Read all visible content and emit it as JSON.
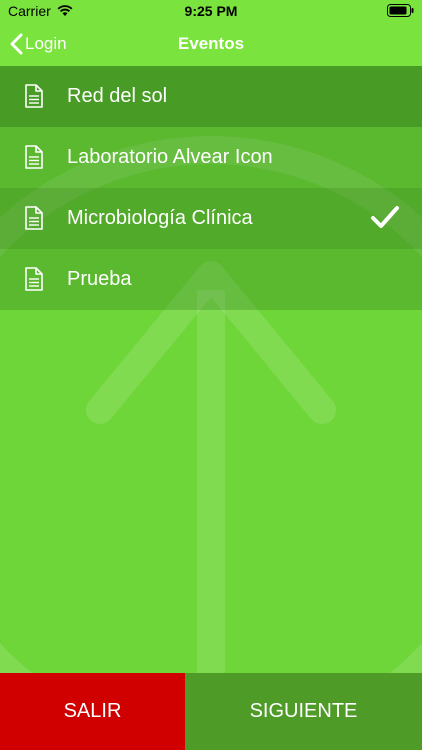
{
  "status_bar": {
    "carrier": "Carrier",
    "time": "9:25 PM"
  },
  "nav": {
    "back_label": "Login",
    "title": "Eventos"
  },
  "events": [
    {
      "label": "Red del sol",
      "icon": "document-icon",
      "selected": false
    },
    {
      "label": "Laboratorio Alvear Icon",
      "icon": "document-icon",
      "selected": false
    },
    {
      "label": "Microbiología Clínica",
      "icon": "document-icon",
      "selected": true
    },
    {
      "label": "Prueba",
      "icon": "document-icon",
      "selected": false
    }
  ],
  "footer": {
    "exit_label": "SALIR",
    "next_label": "SIGUIENTE"
  },
  "colors": {
    "background": "#6fd63a",
    "exit_button": "#d10000",
    "next_button": "#4e9b27"
  }
}
